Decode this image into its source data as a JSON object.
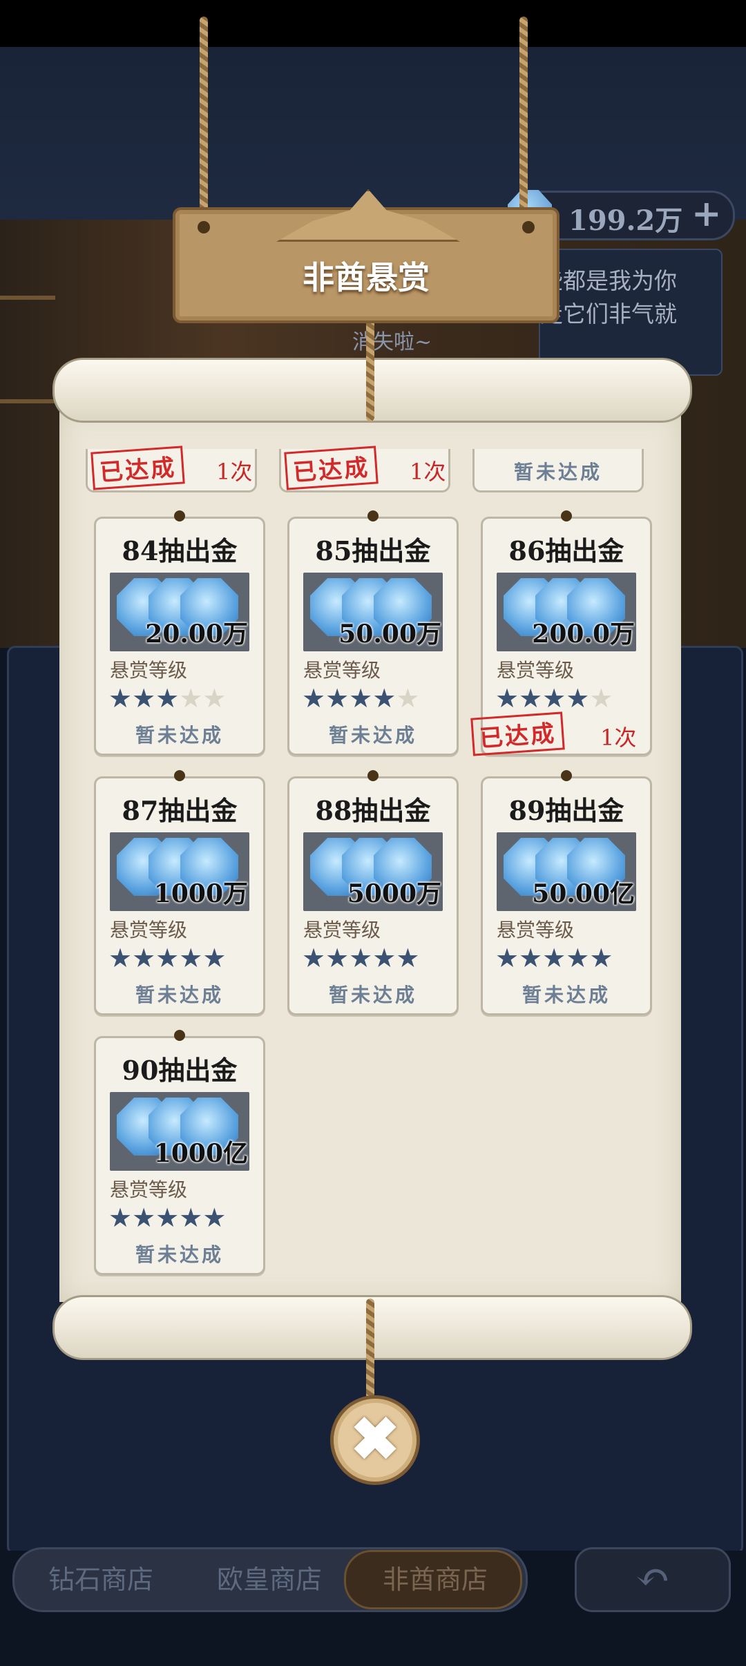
{
  "title": "非酋悬赏",
  "currency": {
    "amount": "199.2万",
    "plus": "+"
  },
  "speech": {
    "line1": "些都是我为你",
    "line2": "走它们非气就",
    "bottom": "消失啦~"
  },
  "labels": {
    "level": "悬赏等级",
    "not_achieved": "暂未达成",
    "achieved": "已达成"
  },
  "top_partial": [
    {
      "status": "已达成",
      "times": "1次"
    },
    {
      "status": "已达成",
      "times": "1次"
    },
    {
      "status": "暂未达成",
      "times": ""
    }
  ],
  "bounties": [
    {
      "title": "84抽出金",
      "amount": "20.00万",
      "stars": 3,
      "max_stars": 5,
      "status": "暂未达成",
      "times": ""
    },
    {
      "title": "85抽出金",
      "amount": "50.00万",
      "stars": 4,
      "max_stars": 5,
      "status": "暂未达成",
      "times": ""
    },
    {
      "title": "86抽出金",
      "amount": "200.0万",
      "stars": 4,
      "max_stars": 5,
      "status": "已达成",
      "times": "1次"
    },
    {
      "title": "87抽出金",
      "amount": "1000万",
      "stars": 5,
      "max_stars": 5,
      "status": "暂未达成",
      "times": ""
    },
    {
      "title": "88抽出金",
      "amount": "5000万",
      "stars": 5,
      "max_stars": 5,
      "status": "暂未达成",
      "times": ""
    },
    {
      "title": "89抽出金",
      "amount": "50.00亿",
      "stars": 5,
      "max_stars": 5,
      "status": "暂未达成",
      "times": ""
    },
    {
      "title": "90抽出金",
      "amount": "1000亿",
      "stars": 5,
      "max_stars": 5,
      "status": "暂未达成",
      "times": ""
    }
  ],
  "close_icon": "✖",
  "tabs": [
    {
      "label": "钻石商店",
      "active": false
    },
    {
      "label": "欧皇商店",
      "active": false
    },
    {
      "label": "非酋商店",
      "active": true
    }
  ],
  "back_icon": "↶",
  "colors": {
    "star_on": "#3b5273",
    "star_off": "#d8d4c6",
    "stamp": "#d22a2a",
    "board": "#b99666"
  }
}
